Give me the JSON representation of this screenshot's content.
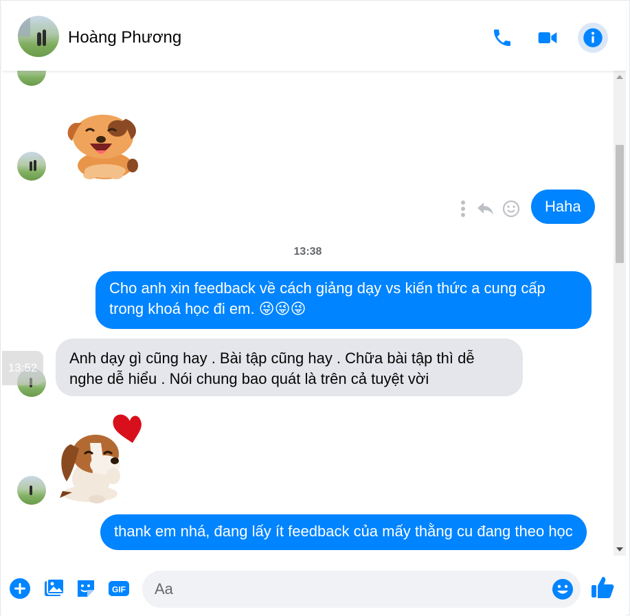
{
  "header": {
    "contact_name": "Hoàng Phương",
    "call_icon": "phone-icon",
    "video_icon": "video-camera-icon",
    "info_icon": "info-icon"
  },
  "messages": {
    "out_haha": "Haha",
    "timestamp_1": "13:38",
    "out_feedback_request": "Cho anh xin feedback về cách giảng dạy vs kiến thức a cung cấp trong khoá học đi em. 😜😜😜",
    "in_feedback_reply": "Anh dạy gì cũng hay . Bài tập cũng hay . Chữa bài tập thì dễ nghe dễ hiểu . Nói chung bao quát là trên cả tuyệt vời",
    "hover_time": "13:52",
    "out_thanks": "thank em nhá, đang lấy ít feedback của mấy thằng cu đang theo học"
  },
  "stickers": {
    "sticker_1": "puppy-laughing-sticker",
    "sticker_2": "beagle-heart-sticker"
  },
  "composer": {
    "placeholder": "Aa",
    "icons": [
      "add-icon",
      "photo-icon",
      "sticker-icon",
      "gif-icon",
      "emoji-icon",
      "thumbs-up-icon"
    ],
    "gif_label": "GIF"
  },
  "colors": {
    "accent": "#0084ff",
    "incoming_bubble": "#e4e6eb",
    "icon_blue": "#0084ff"
  }
}
